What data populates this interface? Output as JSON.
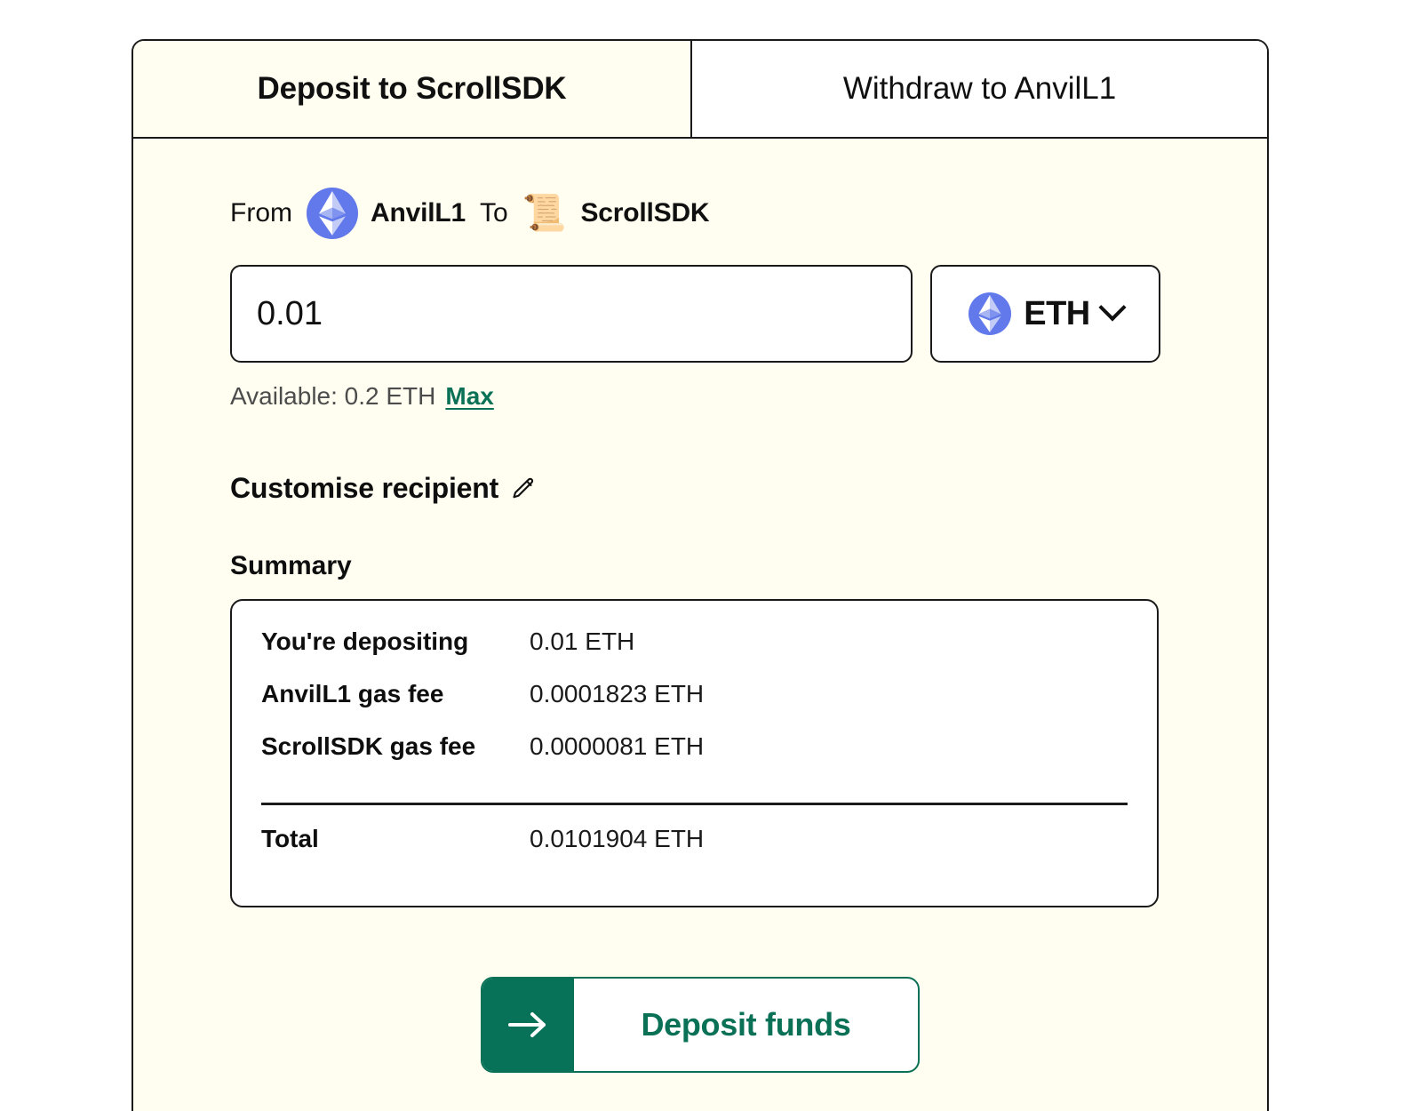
{
  "tabs": [
    {
      "label": "Deposit to ScrollSDK",
      "active": true
    },
    {
      "label": "Withdraw to AnvilL1",
      "active": false
    }
  ],
  "route": {
    "from_label": "From",
    "from_chain": "AnvilL1",
    "from_icon": "ethereum-icon",
    "to_label": "To",
    "to_chain": "ScrollSDK",
    "to_icon": "scroll-emoji",
    "to_icon_glyph": "📜"
  },
  "amount": {
    "value": "0.01",
    "placeholder": "0.0",
    "token_symbol": "ETH",
    "token_icon": "ethereum-icon",
    "chevron_icon": "chevron-down-icon"
  },
  "balance": {
    "available_text": "Available: 0.2 ETH",
    "max_label": "Max"
  },
  "recipient": {
    "label": "Customise recipient",
    "edit_icon": "pencil-icon"
  },
  "summary": {
    "title": "Summary",
    "rows": [
      {
        "key": "You're depositing",
        "value": "0.01 ETH"
      },
      {
        "key": "AnvilL1 gas fee",
        "value": "0.0001823 ETH"
      },
      {
        "key": "ScrollSDK gas fee",
        "value": "0.0000081 ETH"
      }
    ],
    "total": {
      "key": "Total",
      "value": "0.0101904 ETH"
    }
  },
  "action": {
    "label": "Deposit funds",
    "icon": "arrow-right-icon"
  },
  "colors": {
    "card_background": "#FFFEF0",
    "page_background": "#FFFFFF",
    "accent_green": "#0A7157",
    "button_green": "#087259",
    "eth_blue": "#6179EA",
    "border": "#1A1A1A",
    "muted_text": "#4C4C4C"
  }
}
